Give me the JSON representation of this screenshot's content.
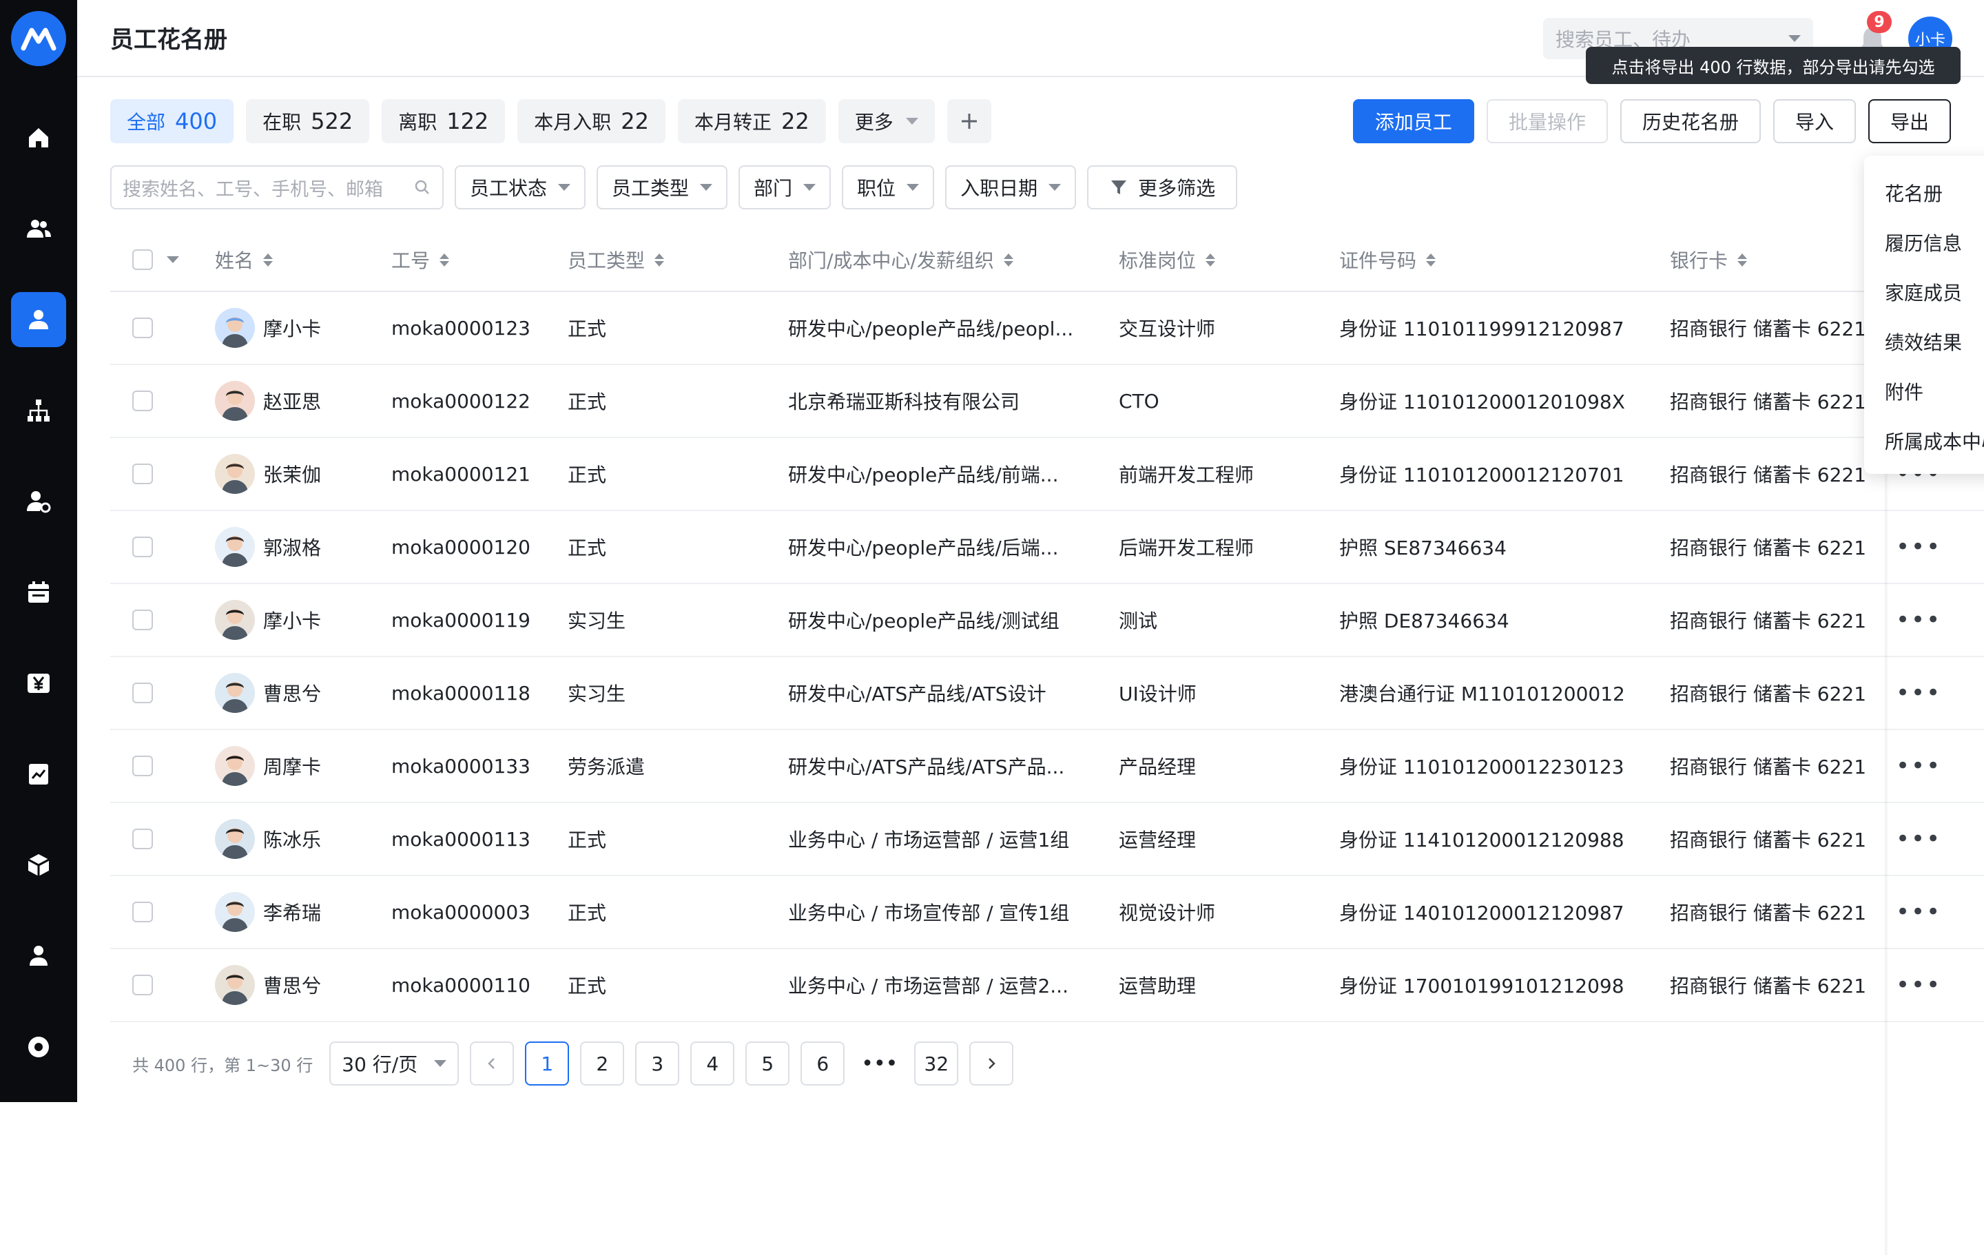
{
  "sidebar": {
    "items": [
      {
        "icon": "home-icon"
      },
      {
        "icon": "team-icon"
      },
      {
        "icon": "user-icon",
        "active": true
      },
      {
        "icon": "org-chart-icon"
      },
      {
        "icon": "user-settings-icon"
      },
      {
        "icon": "calendar-icon"
      },
      {
        "icon": "yen-icon"
      },
      {
        "icon": "report-icon"
      },
      {
        "icon": "box-icon"
      },
      {
        "icon": "person-icon"
      },
      {
        "icon": "settings-circle-icon"
      }
    ]
  },
  "header": {
    "title": "员工花名册",
    "search_placeholder": "搜索员工、待办",
    "notification_count": "9",
    "user_name": "小卡",
    "tooltip": "点击将导出 400 行数据，部分导出请先勾选"
  },
  "tabs": [
    {
      "label": "全部",
      "count": "400",
      "active": true
    },
    {
      "label": "在职",
      "count": "522"
    },
    {
      "label": "离职",
      "count": "122"
    },
    {
      "label": "本月入职",
      "count": "22"
    },
    {
      "label": "本月转正",
      "count": "22"
    }
  ],
  "tabs_more": "更多",
  "actions": {
    "add": "添加员工",
    "batch": "批量操作",
    "history": "历史花名册",
    "import": "导入",
    "export": "导出"
  },
  "filters": {
    "search_placeholder": "搜索姓名、工号、手机号、邮箱",
    "status": "员工状态",
    "type": "员工类型",
    "dept": "部门",
    "position": "职位",
    "hire_date": "入职日期",
    "more": "更多筛选"
  },
  "table": {
    "columns": [
      "姓名",
      "工号",
      "员工类型",
      "部门/成本中心/发薪组织",
      "标准岗位",
      "证件号码",
      "银行卡"
    ],
    "rows": [
      {
        "name": "摩小卡",
        "id": "moka0000123",
        "type": "正式",
        "dept": "研发中心/people产品线/peopl...",
        "post": "交互设计师",
        "cert": "身份证 110101199912120987",
        "bank": "招商银行 储蓄卡 6221"
      },
      {
        "name": "赵亚思",
        "id": "moka0000122",
        "type": "正式",
        "dept": "北京希瑞亚斯科技有限公司",
        "post": "CTO",
        "cert": "身份证 11010120001201098X",
        "bank": "招商银行 储蓄卡 6221"
      },
      {
        "name": "张茉伽",
        "id": "moka0000121",
        "type": "正式",
        "dept": "研发中心/people产品线/前端...",
        "post": "前端开发工程师",
        "cert": "身份证 110101200012120701",
        "bank": "招商银行 储蓄卡 6221"
      },
      {
        "name": "郭淑格",
        "id": "moka0000120",
        "type": "正式",
        "dept": "研发中心/people产品线/后端...",
        "post": "后端开发工程师",
        "cert": "护照 SE87346634",
        "bank": "招商银行 储蓄卡 6221"
      },
      {
        "name": "摩小卡",
        "id": "moka0000119",
        "type": "实习生",
        "dept": "研发中心/people产品线/测试组",
        "post": "测试",
        "cert": "护照 DE87346634",
        "bank": "招商银行 储蓄卡 6221"
      },
      {
        "name": "曹思兮",
        "id": "moka0000118",
        "type": "实习生",
        "dept": "研发中心/ATS产品线/ATS设计",
        "post": "UI设计师",
        "cert": "港澳台通行证 M110101200012",
        "bank": "招商银行 储蓄卡 6221"
      },
      {
        "name": "周摩卡",
        "id": "moka0000133",
        "type": "劳务派遣",
        "dept": "研发中心/ATS产品线/ATS产品...",
        "post": "产品经理",
        "cert": "身份证 110101200012230123",
        "bank": "招商银行 储蓄卡 6221"
      },
      {
        "name": "陈冰乐",
        "id": "moka0000113",
        "type": "正式",
        "dept": "业务中心 / 市场运营部 / 运营1组",
        "post": "运营经理",
        "cert": "身份证 114101200012120988",
        "bank": "招商银行 储蓄卡 6221"
      },
      {
        "name": "李希瑞",
        "id": "moka0000003",
        "type": "正式",
        "dept": "业务中心 / 市场宣传部 / 宣传1组",
        "post": "视觉设计师",
        "cert": "身份证 140101200012120987",
        "bank": "招商银行 储蓄卡 6221"
      },
      {
        "name": "曹思兮",
        "id": "moka0000110",
        "type": "正式",
        "dept": "业务中心 / 市场运营部 / 运营2...",
        "post": "运营助理",
        "cert": "身份证 170010199101212098",
        "bank": "招商银行 储蓄卡 6221"
      }
    ]
  },
  "export_menu": [
    "花名册",
    "履历信息",
    "家庭成员",
    "绩效结果",
    "附件",
    "所属成本中心"
  ],
  "pagination": {
    "total": "共 400 行，第 1~30 行",
    "page_size": "30 行/页",
    "pages": [
      "1",
      "2",
      "3",
      "4",
      "5",
      "6"
    ],
    "ellipsis": "•••",
    "last": "32",
    "current": "1"
  },
  "colors": {
    "accent": "#1d6ff2",
    "sidebar": "#0a0c10",
    "badge": "#f0484f"
  }
}
